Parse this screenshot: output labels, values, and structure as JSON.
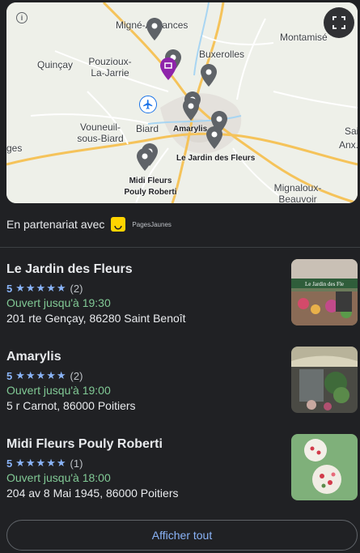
{
  "map": {
    "places": [
      "Migné-Auxances",
      "Montamisé",
      "Quinçay",
      "Pouzioux-La-Jarrie",
      "Buxerolles",
      "Vouneuil-sous-Biard",
      "Biard",
      "Amarylis",
      "Le Jardin des Fleurs",
      "Midi Fleurs Pouly Roberti",
      "Mignaloux-Beauvoir",
      "Sai...",
      "Anx...",
      "ges"
    ],
    "info_label": "i",
    "icons": [
      "info-icon",
      "fullscreen-icon",
      "airport-icon",
      "location-pin-icon",
      "shopping-pin-icon"
    ]
  },
  "partner": {
    "text": "En partenariat avec",
    "brand": "PagesJaunes"
  },
  "listings": [
    {
      "name": "Le Jardin des Fleurs",
      "score": "5",
      "stars": "★★★★★",
      "count": "(2)",
      "hours": "Ouvert jusqu'à 19:30",
      "address": "201 rte Gençay, 86280 Saint Benoît",
      "thumb_sign": "Le Jardin des Fle"
    },
    {
      "name": "Amarylis",
      "score": "5",
      "stars": "★★★★★",
      "count": "(2)",
      "hours": "Ouvert jusqu'à 19:00",
      "address": "5 r Carnot, 86000 Poitiers"
    },
    {
      "name": "Midi Fleurs Pouly Roberti",
      "score": "5",
      "stars": "★★★★★",
      "count": "(1)",
      "hours": "Ouvert jusqu'à 18:00",
      "address": "204 av 8 Mai 1945, 86000 Poitiers"
    }
  ],
  "show_all": "Afficher tout",
  "colors": {
    "background": "#202124",
    "link": "#8ab4f8",
    "open": "#81c995",
    "pin": "#5f6368",
    "selected_pin": "#8e24aa"
  }
}
